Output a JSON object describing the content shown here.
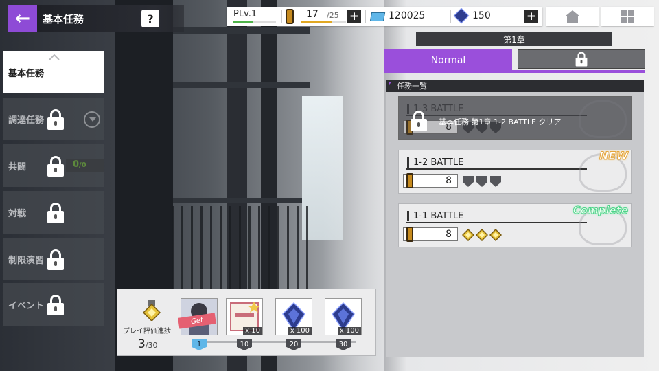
{
  "header": {
    "back_icon": "back-arrow-icon",
    "title": "基本任務",
    "help_label": "?"
  },
  "resources": {
    "player_level": "PLv.1",
    "player_level_progress": 0.45,
    "stamina_current": "17",
    "stamina_max": "/25",
    "stamina_progress": 0.68,
    "stamina_plus": "+",
    "tickets": "120025",
    "gems": "150",
    "gems_plus": "+"
  },
  "nav": {
    "home_icon": "home-icon",
    "menu_icon": "grid-menu-icon"
  },
  "sidebar": {
    "items": [
      {
        "label": "基本任務",
        "active": true,
        "locked": false
      },
      {
        "label": "調達任務",
        "active": false,
        "locked": true
      },
      {
        "label": "共闘",
        "active": false,
        "locked": true,
        "count": "0",
        "count_max": "/0"
      },
      {
        "label": "対戦",
        "active": false,
        "locked": true
      },
      {
        "label": "制限演習",
        "active": false,
        "locked": true
      },
      {
        "label": "イベント",
        "active": false,
        "locked": true
      }
    ]
  },
  "chapter": {
    "title": "第1章",
    "tabs": [
      {
        "label": "Normal",
        "active": true,
        "locked": false
      },
      {
        "label": "",
        "active": false,
        "locked": true
      }
    ]
  },
  "mission_list": {
    "header": "任務一覧",
    "missions": [
      {
        "title": "1-3 BATTLE",
        "cost": "8",
        "locked": true,
        "lock_message": "基本任務 第1章 1-2 BATTLE クリア",
        "badge": "",
        "medals_earned": 0
      },
      {
        "title": "1-2 BATTLE",
        "cost": "8",
        "locked": false,
        "badge": "NEW",
        "medals_earned": 0
      },
      {
        "title": "1-1 BATTLE",
        "cost": "8",
        "locked": false,
        "badge": "Complete",
        "medals_earned": 3
      }
    ]
  },
  "rewards": {
    "progress_label": "プレイ評価進捗",
    "progress_current": "3",
    "progress_max": "/30",
    "items": [
      {
        "name": "character-card",
        "qty": "",
        "claimable": true,
        "get_label": "Get",
        "milestone": "1"
      },
      {
        "name": "battle-ticket",
        "qty": "x 10",
        "claimable": false,
        "milestone": "10"
      },
      {
        "name": "gem",
        "qty": "x 100",
        "claimable": false,
        "milestone": "20"
      },
      {
        "name": "gem",
        "qty": "x 100",
        "claimable": false,
        "milestone": "30"
      }
    ]
  },
  "colors": {
    "accent": "#9a4fdb",
    "stamina": "#e1a823",
    "level": "#4fb34a",
    "new_badge": "#e6a63c",
    "complete_badge": "#4fd38a"
  }
}
